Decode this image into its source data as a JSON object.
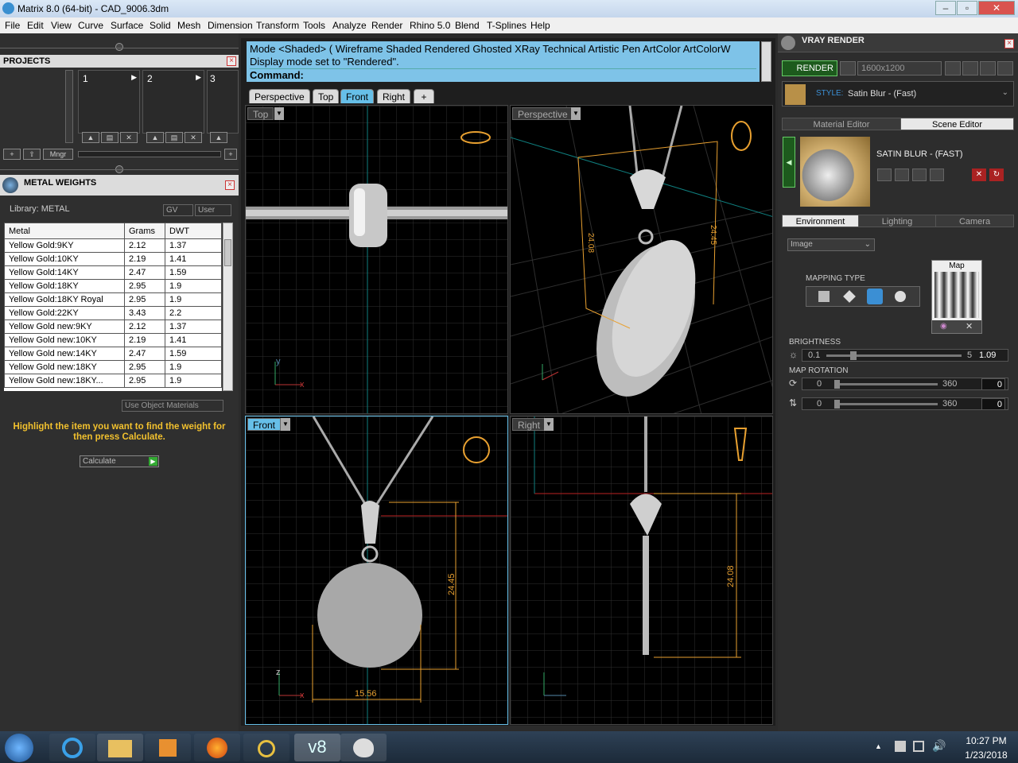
{
  "window": {
    "title": "Matrix 8.0 (64-bit) - CAD_9006.3dm",
    "min": "–",
    "max": "▫",
    "close": "✕"
  },
  "menu": [
    "File",
    "Edit",
    "View",
    "Curve",
    "Surface",
    "Solid",
    "Mesh",
    "Dimension",
    "Transform",
    "Tools",
    "Analyze",
    "Render",
    "Rhino 5.0",
    "Blend",
    "T-Splines",
    "Help"
  ],
  "projects": {
    "title": "PROJECTS",
    "slots": [
      "1",
      "2",
      "3"
    ],
    "manager_label": "Mngr"
  },
  "metal_weights": {
    "title": "METAL WEIGHTS",
    "library_label": "Library: METAL",
    "gv_label": "GV",
    "user_label": "User",
    "columns": [
      "Metal",
      "Grams",
      "DWT"
    ],
    "rows": [
      [
        "Yellow Gold:9KY",
        "2.12",
        "1.37"
      ],
      [
        "Yellow Gold:10KY",
        "2.19",
        "1.41"
      ],
      [
        "Yellow Gold:14KY",
        "2.47",
        "1.59"
      ],
      [
        "Yellow Gold:18KY",
        "2.95",
        "1.9"
      ],
      [
        "Yellow Gold:18KY Royal",
        "2.95",
        "1.9"
      ],
      [
        "Yellow Gold:22KY",
        "3.43",
        "2.2"
      ],
      [
        "Yellow Gold new:9KY",
        "2.12",
        "1.37"
      ],
      [
        "Yellow Gold new:10KY",
        "2.19",
        "1.41"
      ],
      [
        "Yellow Gold new:14KY",
        "2.47",
        "1.59"
      ],
      [
        "Yellow Gold new:18KY",
        "2.95",
        "1.9"
      ],
      [
        "Yellow Gold new:18KY...",
        "2.95",
        "1.9"
      ]
    ],
    "use_object_materials": "Use Object Materials",
    "hint": "Highlight the item you want to find the weight for then press Calculate.",
    "calculate_label": "Calculate"
  },
  "command": {
    "line1": "Mode <Shaded> ( Wireframe  Shaded  Rendered  Ghosted  XRay  Technical  Artistic  Pen  ArtColor  ArtColorW",
    "line2": "Display mode set to \"Rendered\".",
    "prompt": "Command:"
  },
  "viewport_tabs": [
    "Perspective",
    "Top",
    "Front",
    "Right",
    "+"
  ],
  "active_viewport_tab": "Front",
  "viewports": {
    "top": "Top",
    "perspective": "Perspective",
    "front": "Front",
    "right": "Right"
  },
  "dimensions": {
    "persp_left": "24.08",
    "persp_right": "24.45",
    "front_height": "24.45",
    "front_width": "15.56",
    "right_height": "24.08"
  },
  "vray": {
    "title": "VRAY RENDER",
    "render_label": "RENDER",
    "resolution": "1600x1200",
    "style_label": "STYLE:",
    "style_value": "Satin Blur - (Fast)",
    "tabs": [
      "Material Editor",
      "Scene Editor"
    ],
    "active_tab": "Scene Editor",
    "material_name": "SATIN BLUR - (FAST)",
    "env_tabs": [
      "Environment",
      "Lighting",
      "Camera"
    ],
    "active_env_tab": "Environment",
    "env_type": "Image",
    "mapping_type_label": "MAPPING TYPE",
    "map_label": "Map",
    "brightness_label": "BRIGHTNESS",
    "brightness_min": "0.1",
    "brightness_max": "5",
    "brightness_value": "1.09",
    "map_rotation_label": "MAP ROTATION",
    "rot1_min": "0",
    "rot1_max": "360",
    "rot1_value": "0",
    "rot2_min": "0",
    "rot2_max": "360",
    "rot2_value": "0"
  },
  "taskbar": {
    "time": "10:27 PM",
    "date": "1/23/2018",
    "v8_label": "v8"
  },
  "colors": {
    "accent_blue": "#66bfe8",
    "command_bg": "#7ec3e8",
    "hint_yellow": "#f2c12e",
    "dim_orange": "#e8a030"
  }
}
